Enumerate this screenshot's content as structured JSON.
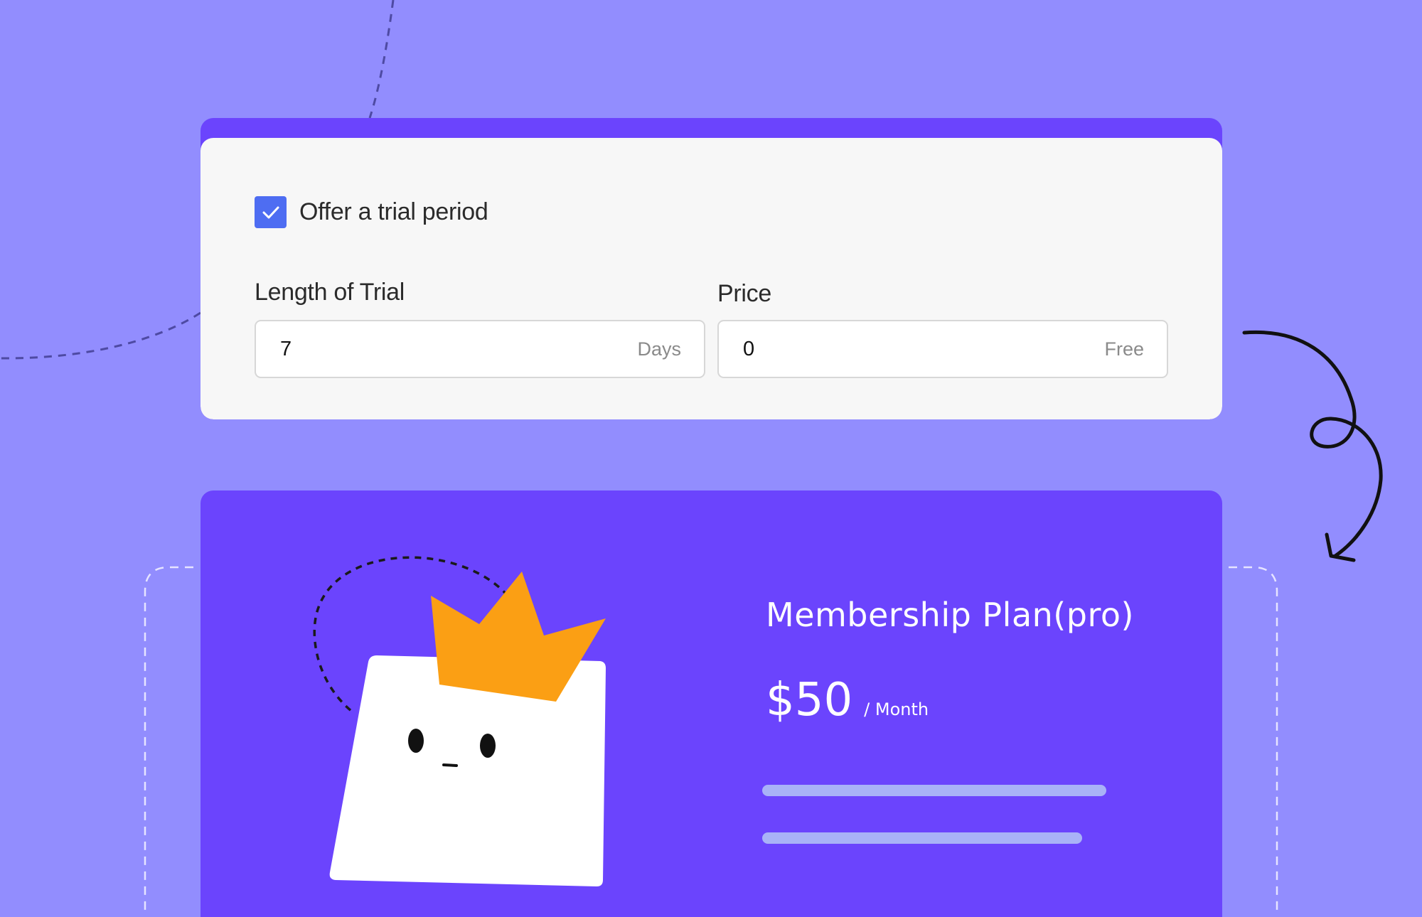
{
  "colors": {
    "background": "#928dfe",
    "accent": "#6b44fd",
    "checkbox": "#4e6df2",
    "crown": "#fb9f14",
    "feature_line": "#a9b2f7"
  },
  "settings": {
    "trial_checkbox_checked": true,
    "trial_label": "Offer a trial period",
    "length": {
      "label": "Length of Trial",
      "value": "7",
      "suffix": "Days"
    },
    "price": {
      "label": "Price",
      "value": "0",
      "suffix": "Free"
    }
  },
  "plan": {
    "title": "Membership Plan(pro)",
    "price": "$50",
    "period": "/ Month",
    "illustration": "crowned-square-mascot"
  }
}
